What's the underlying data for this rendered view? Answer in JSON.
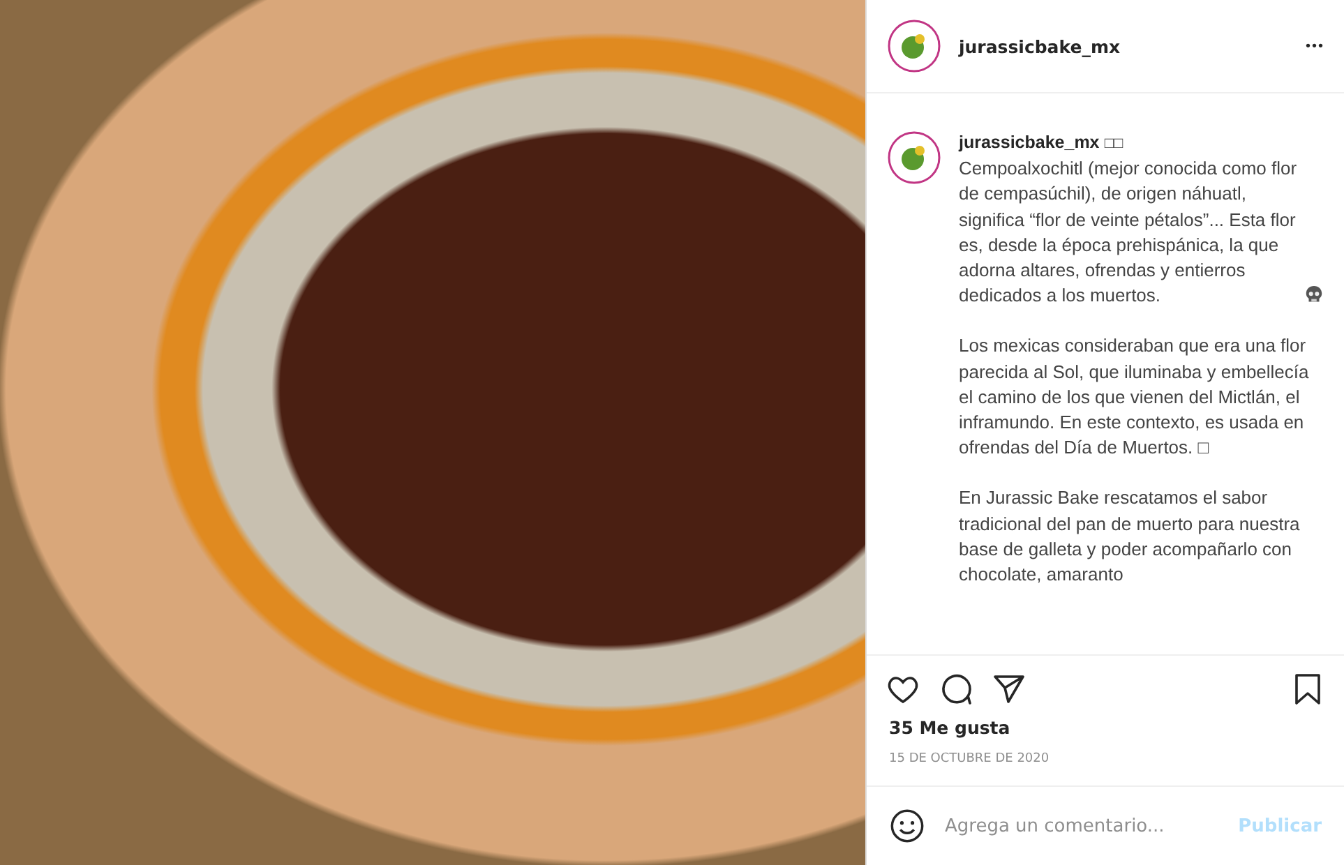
{
  "post": {
    "username": "jurassicbake_mx",
    "menu": "•••"
  },
  "caption": {
    "username": "jurassicbake_mx",
    "marks": "□□",
    "paragraphs": [
      {
        "text": "Cempoalxochitl (mejor conocida como flor de cempasúchil), de origen náhuatl, significa “flor de veinte pétalos”... Esta flor es, desde la época prehispánica, la que adorna altares, ofrendas y entierros dedicados a los muertos.",
        "skull": true
      },
      {
        "text": "Los mexicas consideraban que era una flor parecida al Sol, que iluminaba y embellecía el camino de los que vienen del Mictlán, el inframundo. En este contexto, es usada en ofrendas del Día de Muertos. □",
        "skull": false
      },
      {
        "text": "En Jurassic Bake rescatamos el sabor tradicional del pan de muerto para nuestra base de galleta y poder acompañarlo con chocolate, amaranto",
        "skull": false
      }
    ]
  },
  "likes": "35 Me gusta",
  "date": "15 DE OCTUBRE DE 2020",
  "comment": {
    "placeholder": "Agrega un comentario...",
    "submit": "Publicar",
    "submit_disabled": true
  }
}
